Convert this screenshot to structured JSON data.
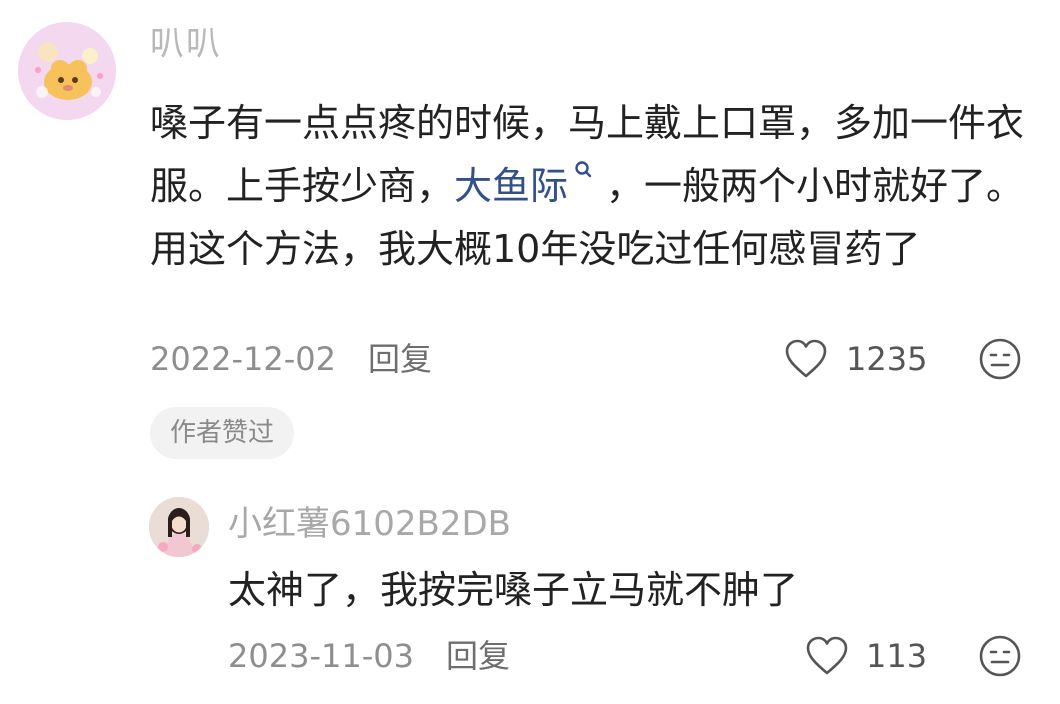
{
  "main_comment": {
    "username": "叭叭",
    "text_before_link": "嗓子有一点点疼的时候，马上戴上口罩，多加一件衣服。上手按少商，",
    "link_text": "大鱼际",
    "link_icon": "search-icon",
    "text_after_link": "，一般两个小时就好了。用这个方法，我大概10年没吃过任何感冒药了",
    "date": "2022-12-02",
    "reply_label": "回复",
    "like_icon": "heart-outline-icon",
    "like_count": "1235",
    "dislike_icon": "meh-face-icon",
    "badge": "作者赞过"
  },
  "reply_comment": {
    "username": "小红薯6102B2DB",
    "text": "太神了，我按完嗓子立马就不肿了",
    "date": "2023-11-03",
    "reply_label": "回复",
    "like_icon": "heart-outline-icon",
    "like_count": "113",
    "dislike_icon": "meh-face-icon"
  }
}
